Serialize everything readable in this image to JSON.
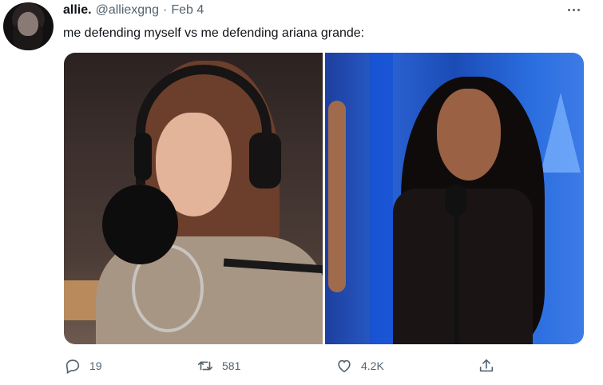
{
  "tweet": {
    "display_name": "allie.",
    "handle": "@alliexgng",
    "separator": "·",
    "date": "Feb 4",
    "text": "me defending myself vs me defending ariana grande:",
    "more_icon": "more-horizontal-icon"
  },
  "media": {
    "images": [
      {
        "name": "left-photo"
      },
      {
        "name": "right-photo"
      }
    ]
  },
  "actions": {
    "reply": {
      "icon": "reply-icon",
      "count": "19"
    },
    "retweet": {
      "icon": "retweet-icon",
      "count": "581"
    },
    "like": {
      "icon": "heart-icon",
      "count": "4.2K"
    },
    "share": {
      "icon": "share-icon",
      "count": ""
    }
  },
  "colors": {
    "text_primary": "#0f1419",
    "text_secondary": "#536471",
    "background": "#ffffff"
  }
}
